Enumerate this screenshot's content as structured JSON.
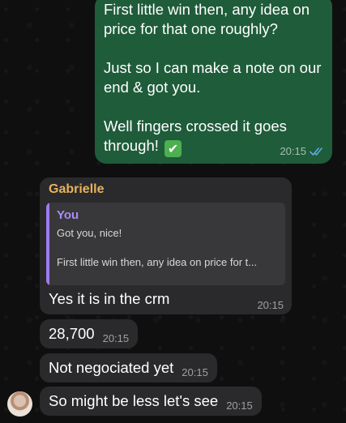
{
  "outgoing": {
    "lines": [
      "First little win then, any idea on",
      "price for that one roughly?",
      "Just so I can make a note on our",
      "end & got you.",
      "Well fingers crossed it goes",
      "through!"
    ],
    "emoji": "✔",
    "time": "20:15",
    "status_icon": "double-check-icon"
  },
  "incoming": {
    "sender": "Gabrielle",
    "reply": {
      "author": "You",
      "line1": "Got you, nice!",
      "line2": "First little win then, any idea on price for t..."
    },
    "messages": [
      {
        "text": "Yes it is in the crm",
        "time": "20:15"
      },
      {
        "text": "28,700",
        "time": "20:15"
      },
      {
        "text": "Not negociated yet",
        "time": "20:15"
      },
      {
        "text": "So might be less let's see",
        "time": "20:15"
      }
    ]
  },
  "colors": {
    "outgoing_bubble": "#1f5c3a",
    "incoming_bubble": "#2a2a2c",
    "sender_name": "#e7b25a",
    "reply_accent": "#9c7cf0",
    "read_check": "#5aa9e6"
  }
}
